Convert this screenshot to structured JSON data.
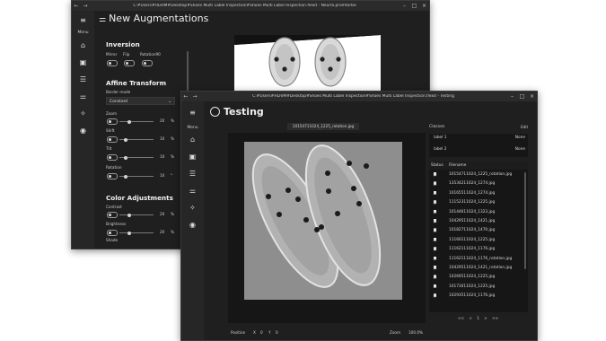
{
  "colors": {
    "window_bg": "#1f1f1f",
    "titlebar": "#2b2b2b",
    "rail": "#262626",
    "panel": "#161616",
    "accent": "#f0f0f0"
  },
  "back_window": {
    "title": "C:#Users#HLRIM#Desktop#Shoes Multi Label Inspection#Shoes Multi Label Inspection.flexit - Neurla.promtorbe",
    "menu_label": "Menu",
    "header_title": "New Augmentations",
    "inversion": {
      "title": "Inversion",
      "labels": [
        "Mirror",
        "Flip",
        "Rotation90"
      ]
    },
    "affine": {
      "title": "Affine Transform",
      "border_mode_label": "Border mode",
      "border_mode_value": "Constant",
      "sliders": [
        {
          "label": "Zoom",
          "value": "20",
          "unit": "%"
        },
        {
          "label": "Shift",
          "value": "10",
          "unit": "%"
        },
        {
          "label": "Tilt",
          "value": "10",
          "unit": "%"
        },
        {
          "label": "Rotation",
          "value": "10",
          "unit": "°"
        }
      ]
    },
    "color_adjust": {
      "title": "Color Adjustments",
      "sliders": [
        {
          "label": "Contrast",
          "value": "20",
          "unit": "%"
        },
        {
          "label": "Brightness",
          "value": "20",
          "unit": "%"
        },
        {
          "label": "Shade",
          "value": "",
          "unit": ""
        }
      ]
    }
  },
  "front_window": {
    "title": "C:#Users#HLRIM#Desktop#Shoes Multi Label Inspection#Shoes Multi Label Inspection.flexit - Testing",
    "menu_label": "Menu",
    "header_title": "Testing",
    "file_tab": "10154711024_1225_rotation.jpg",
    "classes_title": "Classes",
    "edit_label": "Edit",
    "classes": [
      {
        "name": "label 1",
        "state": "None"
      },
      {
        "name": "label 2",
        "state": "None"
      }
    ],
    "list_header": {
      "status": "Status",
      "filename": "Filename"
    },
    "files": [
      "10154711024_1225_rotation.jpg",
      "13534211024_1274.jpg",
      "10165511024_1274.jpg",
      "11152311024_1225.jpg",
      "10144611024_1323.jpg",
      "10429511024_1421.jpg",
      "10182711024_1470.jpg",
      "11160111024_1225.jpg",
      "11162111024_1176.jpg",
      "11162111024_1176_rotation.jpg",
      "10429511024_1421_rotation.jpg",
      "10269511024_1225.jpg",
      "10173011024_1225.jpg",
      "10293511024_1176.jpg"
    ],
    "pagination": {
      "first": "<<",
      "prev": "<",
      "page": "1",
      "next": ">",
      "last": ">>"
    },
    "status": {
      "position_label": "Position",
      "x_label": "X",
      "x_value": "0",
      "y_label": "Y",
      "y_value": "0",
      "zoom_label": "Zoom",
      "zoom_value": "100.0%"
    }
  }
}
